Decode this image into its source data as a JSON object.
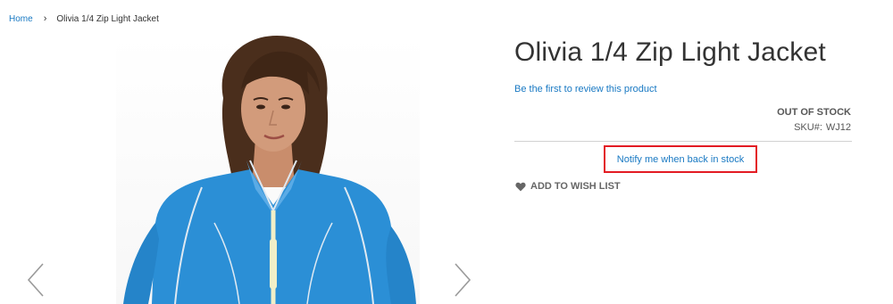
{
  "breadcrumb": {
    "home": "Home",
    "separator": "›",
    "current": "Olivia 1/4 Zip Light Jacket"
  },
  "product": {
    "title": "Olivia 1/4 Zip Light Jacket",
    "review_link": "Be the first to review this product",
    "stock_status": "OUT OF STOCK",
    "sku_label": "SKU#:",
    "sku_value": "WJ12",
    "notify_link": "Notify me when back in stock",
    "wishlist_label": "ADD TO WISH LIST"
  },
  "gallery": {
    "prev_icon": "chevron-left-icon",
    "next_icon": "chevron-right-icon"
  },
  "colors": {
    "link": "#1979c3",
    "highlight_border": "#e31b23",
    "jacket": "#2b8fd6",
    "jacket_piping": "#dfe9f2",
    "zipper": "#f1efc8",
    "text": "#333333"
  }
}
